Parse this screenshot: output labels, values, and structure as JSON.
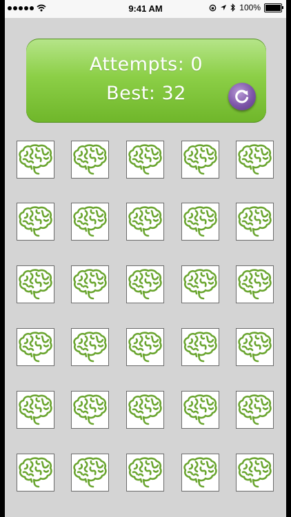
{
  "status_bar": {
    "time": "9:41 AM",
    "battery": "100%",
    "icons": [
      "signal-dots-icon",
      "wifi-icon",
      "lock-rotation-icon",
      "location-icon",
      "bluetooth-icon",
      "battery-icon"
    ]
  },
  "score": {
    "attempts_label": "Attempts: 0",
    "best_label": "Best: 32",
    "reset_icon": "refresh-icon"
  },
  "board": {
    "rows": 6,
    "columns": 5,
    "card_icon": "brain-icon",
    "card_state": "face-down",
    "colors": {
      "brain_stroke": "#6aa52f",
      "panel_green": "#8ccf47",
      "reset_purple": "#7d55a8"
    }
  }
}
